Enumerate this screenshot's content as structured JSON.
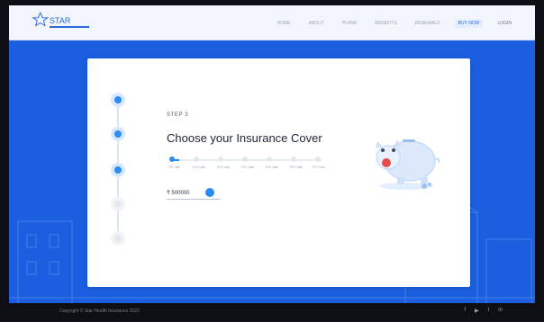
{
  "header": {
    "logo_text": "STAR",
    "nav": [
      {
        "label": "HOME",
        "active": false
      },
      {
        "label": "ABOUT",
        "active": false
      },
      {
        "label": "PLANS",
        "active": false
      },
      {
        "label": "BENEFITS",
        "active": false
      },
      {
        "label": "RENEWALS",
        "active": false
      },
      {
        "label": "BUY NOW",
        "active": true
      },
      {
        "label": "LOGIN",
        "active": false
      }
    ]
  },
  "stepper": {
    "steps": [
      {
        "state": "active"
      },
      {
        "state": "active"
      },
      {
        "state": "active"
      },
      {
        "state": "inactive"
      },
      {
        "state": "inactive"
      }
    ]
  },
  "form": {
    "step_label": "STEP 3",
    "title": "Choose your Insurance Cover",
    "slider": {
      "selected_index": 0,
      "labels": [
        "₹5 Lakh",
        "₹10 Lakh",
        "₹15 Lakh",
        "₹20 Lakh",
        "₹25 Lakh",
        "₹50 Lakh",
        "₹1 Crore"
      ]
    },
    "amount_value": "₹ 500000"
  },
  "illustration": {
    "icon": "piggy-bank-icon"
  },
  "footer": {
    "copyright": "Copyright © Star Health Insurance 2022",
    "social": [
      "f",
      "▶",
      "t",
      "in"
    ]
  },
  "colors": {
    "background_blue": "#1b5fe0",
    "accent": "#2b8cf0",
    "card": "#ffffff"
  }
}
